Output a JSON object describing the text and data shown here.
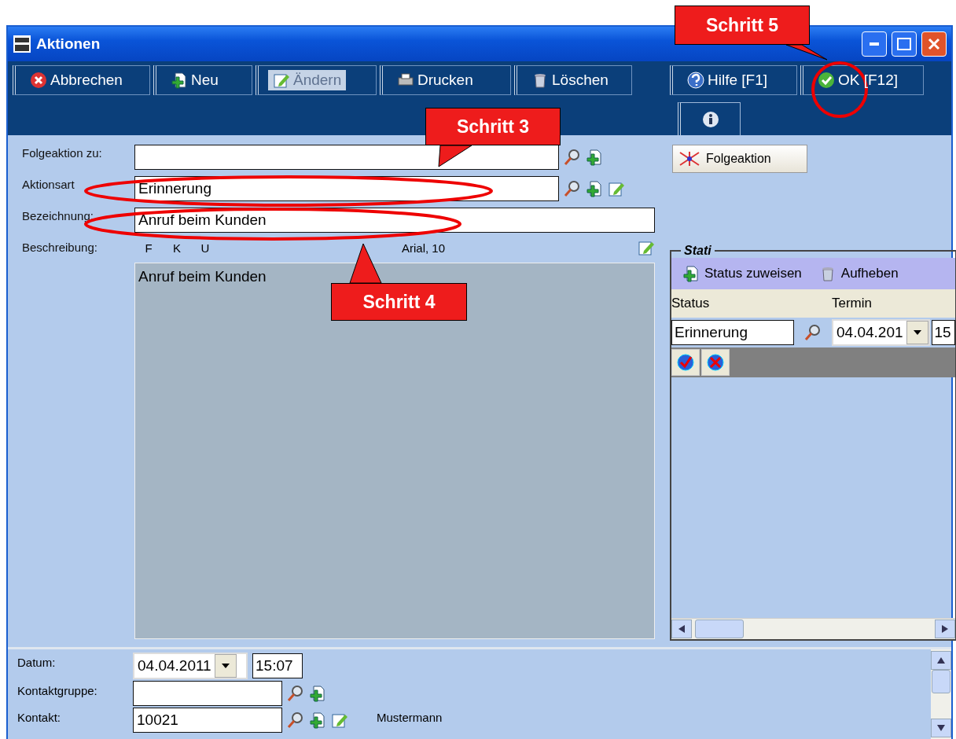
{
  "window": {
    "title": "Aktionen"
  },
  "toolbar": {
    "buttons": [
      {
        "label": "Abbrechen",
        "kind": "cancel",
        "selected": false
      },
      {
        "label": "Neu",
        "kind": "add",
        "selected": false
      },
      {
        "label": "Ändern",
        "kind": "edit",
        "selected": true
      },
      {
        "label": "Drucken",
        "kind": "print",
        "selected": false
      },
      {
        "label": "Löschen",
        "kind": "delete",
        "selected": false
      }
    ],
    "right_buttons": [
      {
        "label": "Hilfe [F1]",
        "kind": "help",
        "selected": false
      },
      {
        "label": "OK [F12]",
        "kind": "ok",
        "selected": false
      }
    ],
    "tabs": [
      {
        "kind": "info",
        "selected": true
      }
    ]
  },
  "form": {
    "fields": [
      {
        "label": "Folgeaktion zu:",
        "icons": [
          {
            "kind": "search"
          },
          {
            "kind": "add"
          }
        ]
      },
      {
        "label": "Aktionsart",
        "value": "Erinnerung",
        "icons": [
          {
            "kind": "search"
          },
          {
            "kind": "add"
          },
          {
            "kind": "edit"
          }
        ]
      },
      {
        "label": "Bezeichnung:",
        "value": "Anruf beim Kunden",
        "wide": true
      }
    ],
    "description": {
      "label": "Beschreibung:",
      "format_buttons": [
        "F",
        "K",
        "U"
      ],
      "font": "Arial, 10",
      "text": "Anruf beim Kunden"
    }
  },
  "followup_button": {
    "label": "Folgeaktion"
  },
  "stati": {
    "title": "Stati",
    "actions": [
      {
        "label": "Status zuweisen",
        "kind": "add"
      },
      {
        "label": "Aufheben",
        "kind": "delete"
      }
    ],
    "columns": [
      "Status",
      "Termin"
    ],
    "row": {
      "status": "Erinnerung",
      "date": "04.04.201",
      "time": "15",
      "buttons": [
        {
          "kind": "confirm"
        },
        {
          "kind": "reject"
        }
      ]
    }
  },
  "bottom": {
    "date_label": "Datum:",
    "date": "04.04.2011",
    "time": "15:07",
    "fields": [
      {
        "label": "Kontaktgruppe:",
        "icons": [
          {
            "kind": "search"
          },
          {
            "kind": "add"
          }
        ]
      },
      {
        "label": "Kontakt:",
        "value": "10021",
        "icons": [
          {
            "kind": "search"
          },
          {
            "kind": "add"
          },
          {
            "kind": "edit"
          }
        ],
        "note": "Mustermann"
      }
    ]
  },
  "annotations": [
    {
      "kind": "callout",
      "label": "Schritt 5"
    },
    {
      "kind": "callout",
      "label": "Schritt 3"
    },
    {
      "kind": "callout",
      "label": "Schritt 4"
    },
    {
      "kind": "ellipse"
    },
    {
      "kind": "ellipse"
    },
    {
      "kind": "circle"
    }
  ]
}
